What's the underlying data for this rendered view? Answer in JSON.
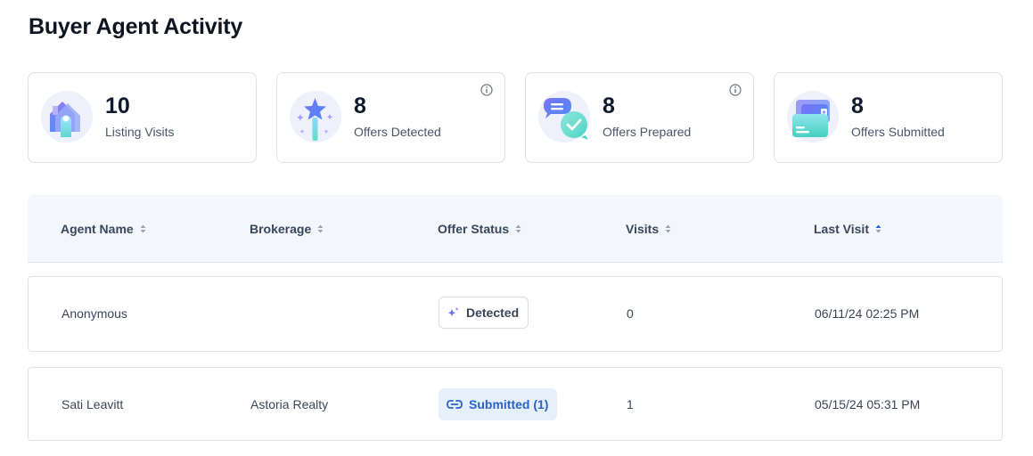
{
  "page": {
    "title": "Buyer Agent Activity"
  },
  "stats": [
    {
      "value": "10",
      "label": "Listing Visits",
      "icon": "house-icon"
    },
    {
      "value": "8",
      "label": "Offers Detected",
      "icon": "magic-wand-icon"
    },
    {
      "value": "8",
      "label": "Offers Prepared",
      "icon": "chat-check-icon"
    },
    {
      "value": "8",
      "label": "Offers Submitted",
      "icon": "folder-icon"
    }
  ],
  "table": {
    "columns": [
      "Agent Name",
      "Brokerage",
      "Offer Status",
      "Visits",
      "Last Visit"
    ],
    "rows": [
      {
        "agent": "Anonymous",
        "brokerage": "",
        "status": "Detected",
        "visits": "0",
        "last_visit": "06/11/24 02:25 PM"
      },
      {
        "agent": "Sati Leavitt",
        "brokerage": "Astoria Realty",
        "status": "Submitted (1)",
        "visits": "1",
        "last_visit": "05/15/24 05:31 PM"
      }
    ]
  },
  "colors": {
    "accent_blue": "#2a63c7",
    "header_bg": "#f3f6fa",
    "card_border": "#dde2e9"
  }
}
